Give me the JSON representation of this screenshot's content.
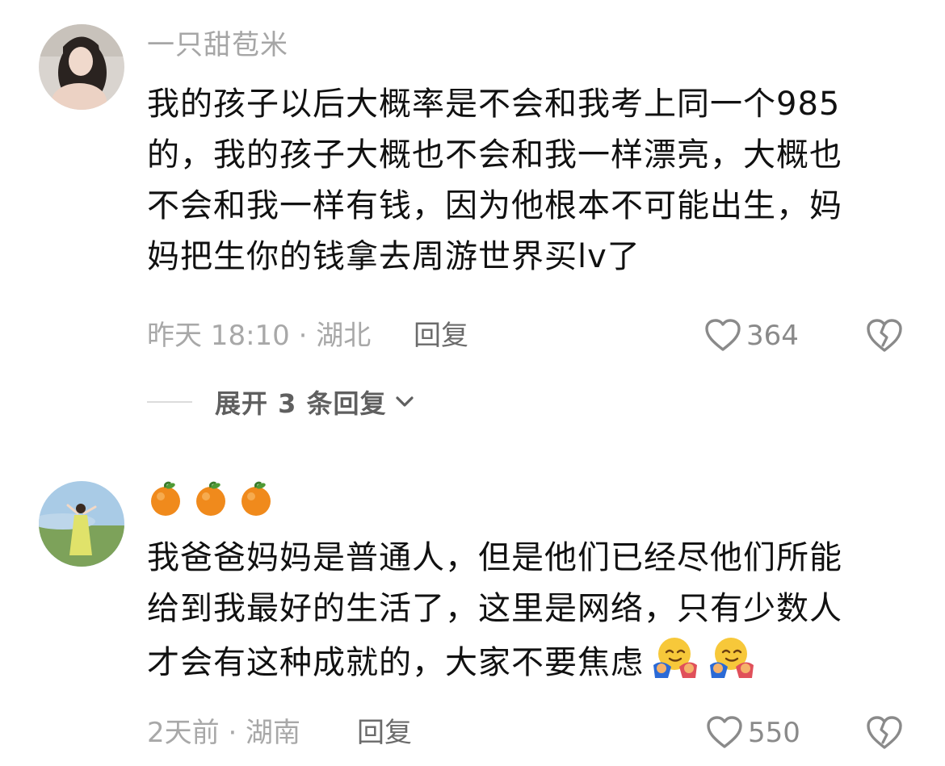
{
  "comments": [
    {
      "username": "一只甜苞米",
      "lines": [
        "我的孩子以后大概率是不会和我考上同一个985",
        "的，我的孩子大概也不会和我一样漂亮，大概也",
        "不会和我一样有钱，因为他根本不可能出生，妈",
        "妈把生你的钱拿去周游世界买lv了"
      ],
      "time_location": "昨天 18:10 · 湖北",
      "reply_label": "回复",
      "likes": "364",
      "expand_replies": "展开 3 条回复"
    },
    {
      "username_emoji": [
        "orange-emoji",
        "orange-emoji",
        "orange-emoji"
      ],
      "lines": [
        "我爸爸妈妈是普通人，但是他们已经尽他们所能",
        "给到我最好的生活了，这里是网络，只有少数人",
        "才会有这种成就的，大家不要焦虑"
      ],
      "trailing_emoji": [
        "hug-emoji",
        "hug-emoji"
      ],
      "time_location": "2天前 · 湖南",
      "reply_label": "回复",
      "likes": "550"
    }
  ],
  "colors": {
    "secondary_text": "#a6a6a6",
    "reply_text": "#6b6b6b",
    "icon": "#8a8a8a"
  }
}
